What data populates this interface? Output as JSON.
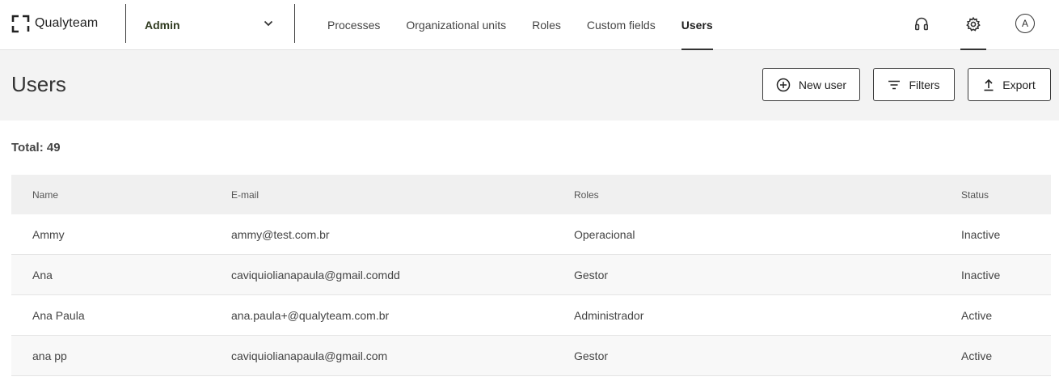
{
  "brand": {
    "name": "Qualyteam"
  },
  "module": {
    "label": "Admin"
  },
  "nav": {
    "items": [
      {
        "label": "Processes"
      },
      {
        "label": "Organizational units"
      },
      {
        "label": "Roles"
      },
      {
        "label": "Custom fields"
      },
      {
        "label": "Users"
      }
    ],
    "active": "Users"
  },
  "user": {
    "initial": "A"
  },
  "page": {
    "title": "Users"
  },
  "actions": {
    "new_user": "New user",
    "filters": "Filters",
    "export": "Export"
  },
  "summary": {
    "total_text": "Total: 49"
  },
  "table": {
    "headers": {
      "name": "Name",
      "email": "E-mail",
      "roles": "Roles",
      "status": "Status"
    },
    "rows": [
      {
        "name": "Ammy",
        "email": "ammy@test.com.br",
        "roles": "Operacional",
        "status": "Inactive"
      },
      {
        "name": "Ana",
        "email": "caviquiolianapaula@gmail.comdd",
        "roles": "Gestor",
        "status": "Inactive"
      },
      {
        "name": "Ana Paula",
        "email": "ana.paula+@qualyteam.com.br",
        "roles": "Administrador",
        "status": "Active"
      },
      {
        "name": "ana pp",
        "email": "caviquiolianapaula@gmail.com",
        "roles": "Gestor",
        "status": "Active"
      }
    ]
  },
  "icons": [
    "logo-icon",
    "chevron-down-icon",
    "headset-icon",
    "gear-icon",
    "plus-circle-icon",
    "filter-icon",
    "upload-icon"
  ]
}
